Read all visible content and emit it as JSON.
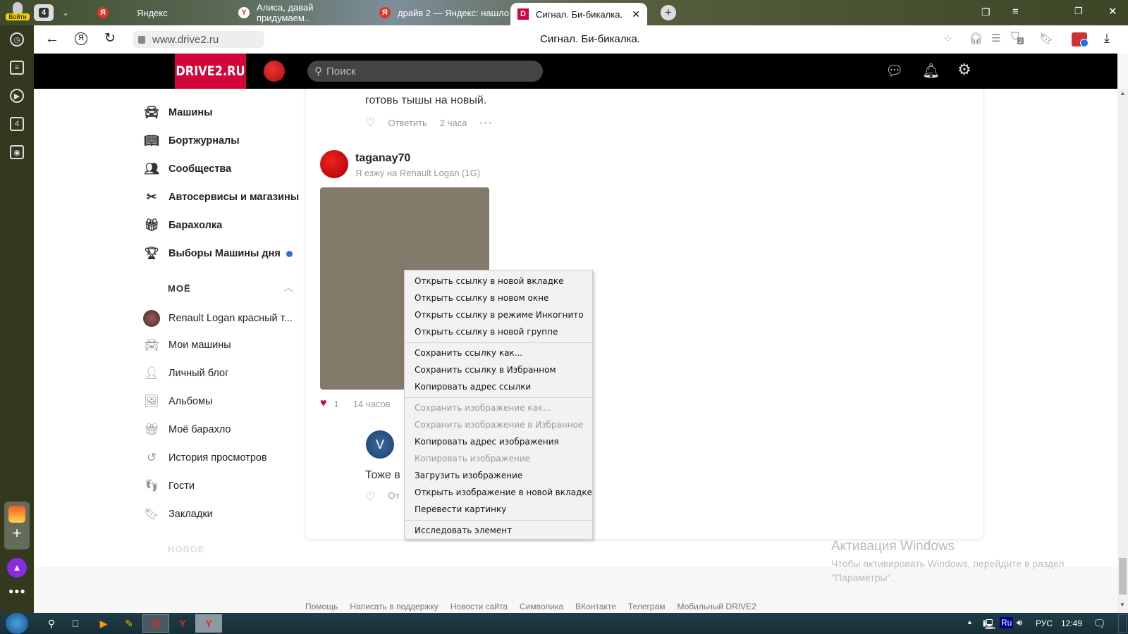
{
  "browser": {
    "login_label": "Войти",
    "tab_count": "4",
    "tabs": [
      {
        "title": "Яндекс",
        "favicon": "Я"
      },
      {
        "title": "Алиса, давай придумаем..",
        "favicon": "Y"
      },
      {
        "title": "драйв 2 — Яндекс: нашло",
        "favicon": "Я"
      },
      {
        "title": "Сигнал. Би-бикалка.",
        "favicon": "D"
      }
    ],
    "address": "www.drive2.ru",
    "page_title": "Сигнал. Би-бикалка.",
    "shield_badge": "2",
    "sidebar_counter": "4"
  },
  "site": {
    "logo": "DRIVE2.RU",
    "search_placeholder": "Поиск",
    "brand_color": "#d2043b"
  },
  "sidebar": {
    "items": [
      {
        "label": "Машины",
        "icon": "car-icon"
      },
      {
        "label": "Бортжурналы",
        "icon": "logbook-icon"
      },
      {
        "label": "Сообщества",
        "icon": "communities-icon"
      },
      {
        "label": "Автосервисы и магазины",
        "icon": "tools-icon"
      },
      {
        "label": "Барахолка",
        "icon": "market-icon"
      },
      {
        "label": "Выборы Машины дня",
        "icon": "trophy-icon"
      }
    ],
    "my_section": "МОЁ",
    "my_items": [
      {
        "label": "Renault Logan красный т...",
        "icon": "car-avatar"
      },
      {
        "label": "Мои машины",
        "icon": "cars-icon"
      },
      {
        "label": "Личный блог",
        "icon": "blog-icon"
      },
      {
        "label": "Альбомы",
        "icon": "album-icon"
      },
      {
        "label": "Моё барахло",
        "icon": "my-market-icon"
      },
      {
        "label": "История просмотров",
        "icon": "history-icon"
      },
      {
        "label": "Гости",
        "icon": "footprints-icon"
      },
      {
        "label": "Закладки",
        "icon": "bookmark-icon"
      }
    ],
    "new_section": "НОВОЕ"
  },
  "comments": {
    "prev_text": "готовь тышы на новый.",
    "prev_reply": "Ответить",
    "prev_time": "2 часа",
    "author": "taganay70",
    "author_sub": "Я езжу на Renault Logan (1G)",
    "likes": "1",
    "time": "14 часов",
    "reply_avatar": "V",
    "reply_text": "Тоже в",
    "reply_label": "От"
  },
  "context_menu": [
    [
      {
        "label": "Открыть ссылку в новой вкладке"
      },
      {
        "label": "Открыть ссылку в новом окне"
      },
      {
        "label": "Открыть ссылку в режиме Инкогнито"
      },
      {
        "label": "Открыть ссылку в новой группе"
      }
    ],
    [
      {
        "label": "Сохранить ссылку как..."
      },
      {
        "label": "Сохранить ссылку в Избранном"
      },
      {
        "label": "Копировать адрес ссылки"
      }
    ],
    [
      {
        "label": "Сохранить изображение как...",
        "disabled": true
      },
      {
        "label": "Сохранить изображение в Избранное",
        "disabled": true
      },
      {
        "label": "Копировать адрес изображения"
      },
      {
        "label": "Копировать изображение",
        "disabled": true
      },
      {
        "label": "Загрузить изображение"
      },
      {
        "label": "Открыть изображение в новой вкладке"
      },
      {
        "label": "Перевести картинку"
      }
    ],
    [
      {
        "label": "Исследовать элемент"
      }
    ]
  ],
  "footer": [
    "Помощь",
    "Написать в поддержку",
    "Новости сайта",
    "Символика",
    "ВКонтакте",
    "Телеграм",
    "Мобильный DRIVE2"
  ],
  "activation": {
    "title": "Активация Windows",
    "line1": "Чтобы активировать Windows, перейдите в раздел",
    "line2": "\"Параметры\"."
  },
  "taskbar": {
    "lang_badge": "Ru",
    "lang": "РУС",
    "time": "12:49"
  }
}
